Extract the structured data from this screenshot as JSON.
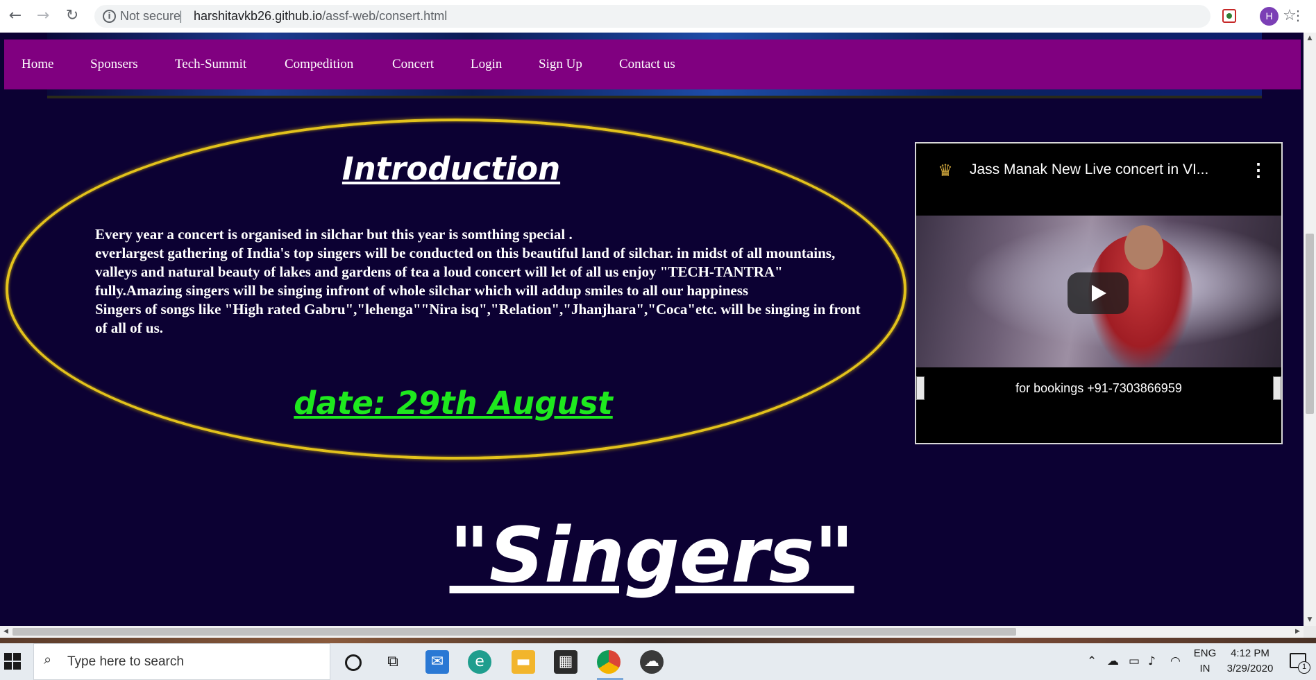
{
  "browser": {
    "back_icon": "back-arrow-icon",
    "forward_icon": "forward-arrow-icon",
    "reload_icon": "reload-icon",
    "security_label": "Not secure",
    "separator": "|",
    "url_host": "harshitavkb26.github.io",
    "url_path": "/assf-web/consert.html",
    "profile_initial": "H"
  },
  "nav": {
    "items": [
      {
        "label": "Home"
      },
      {
        "label": "Sponsers"
      },
      {
        "label": "Tech-Summit"
      },
      {
        "label": "Compedition"
      },
      {
        "label": "Concert"
      },
      {
        "label": "Login"
      },
      {
        "label": "Sign Up"
      },
      {
        "label": "Contact us"
      }
    ],
    "background": "#800080"
  },
  "intro": {
    "title": "Introduction",
    "line1": "Every year a concert is organised in silchar but this year is somthing special .",
    "line2": "everlargest gathering of India's top singers will be conducted on this beautiful land of silchar. in midst of all mountains, valleys and natural beauty of lakes and gardens of tea a loud concert will let of all us enjoy \"TECH-TANTRA\" fully.Amazing singers will be singing infront of whole silchar which will addup smiles to all our happiness",
    "line3": "Singers of songs like \"High rated Gabru\",\"lehenga\"\"Nira isq\",\"Relation\",\"Jhanjhara\",\"Coca\"etc. will be singing in front of all of us.",
    "date": "date: 29th August",
    "border_color": "#e3c21c",
    "date_color": "#1ee81e"
  },
  "video": {
    "title": "Jass Manak New Live concert in VI...",
    "caption": "for bookings +91-7303866959"
  },
  "singers": {
    "heading": "\"Singers\""
  },
  "page_background": "#0c0133",
  "taskbar": {
    "search_placeholder": "Type here to search",
    "language_top": "ENG",
    "language_bottom": "IN",
    "time": "4:12 PM",
    "date": "3/29/2020",
    "notification_count": "1"
  }
}
